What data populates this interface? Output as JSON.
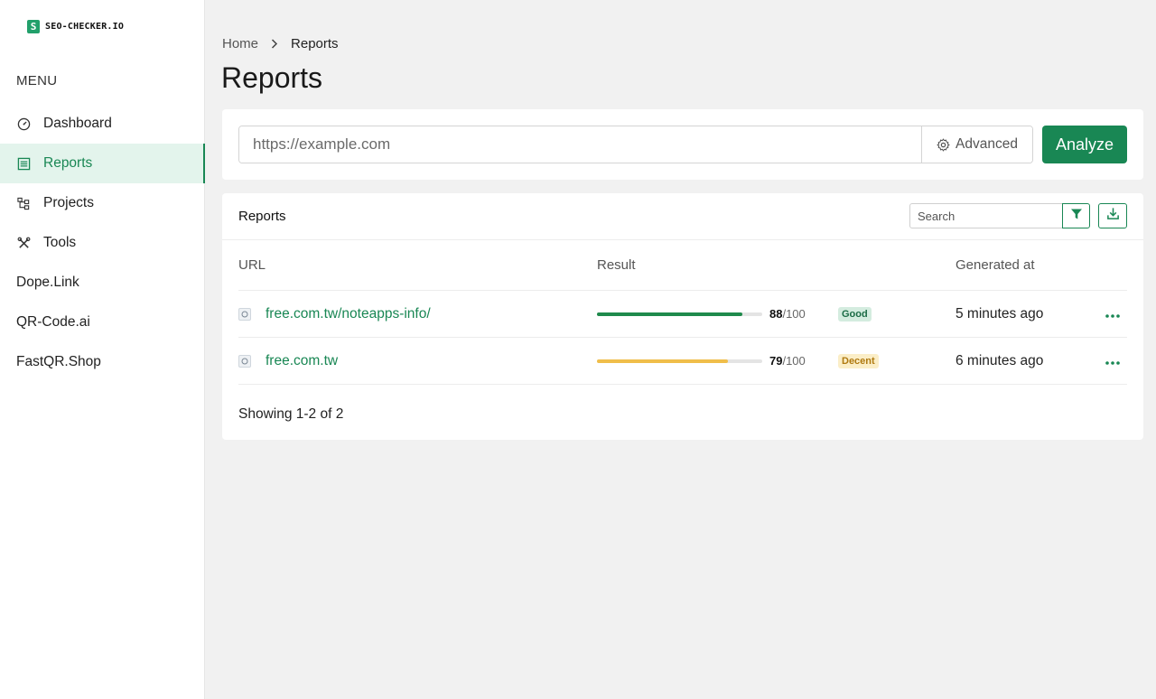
{
  "brand": {
    "logo_mark": "S",
    "name": "SEO-CHECKER.IO",
    "accent": "#198754"
  },
  "sidebar": {
    "menu_title": "MENU",
    "items": [
      {
        "label": "Dashboard",
        "icon": "dashboard-gauge-icon",
        "active": false
      },
      {
        "label": "Reports",
        "icon": "reports-list-icon",
        "active": true
      },
      {
        "label": "Projects",
        "icon": "projects-hierarchy-icon",
        "active": false
      },
      {
        "label": "Tools",
        "icon": "tools-wrench-icon",
        "active": false
      },
      {
        "label": "Dope.Link",
        "icon": null,
        "active": false
      },
      {
        "label": "QR-Code.ai",
        "icon": null,
        "active": false
      },
      {
        "label": "FastQR.Shop",
        "icon": null,
        "active": false
      }
    ]
  },
  "breadcrumb": {
    "home": "Home",
    "current": "Reports"
  },
  "page": {
    "title": "Reports"
  },
  "analyze": {
    "placeholder": "https://example.com",
    "advanced_label": "Advanced",
    "analyze_label": "Analyze"
  },
  "reports": {
    "title": "Reports",
    "search_placeholder": "Search",
    "columns": {
      "url": "URL",
      "result": "Result",
      "generated_at": "Generated at"
    },
    "rows": [
      {
        "url": "free.com.tw/noteapps-info/",
        "score": "88",
        "max": "/100",
        "progress": 0.88,
        "badge": "Good",
        "badge_type": "good",
        "bar_color": "#1f8a4c",
        "generated": "5 minutes ago"
      },
      {
        "url": "free.com.tw",
        "score": "79",
        "max": "/100",
        "progress": 0.79,
        "badge": "Decent",
        "badge_type": "decent",
        "bar_color": "#f0be4a",
        "generated": "6 minutes ago"
      }
    ],
    "footer": "Showing 1-2 of 2"
  }
}
